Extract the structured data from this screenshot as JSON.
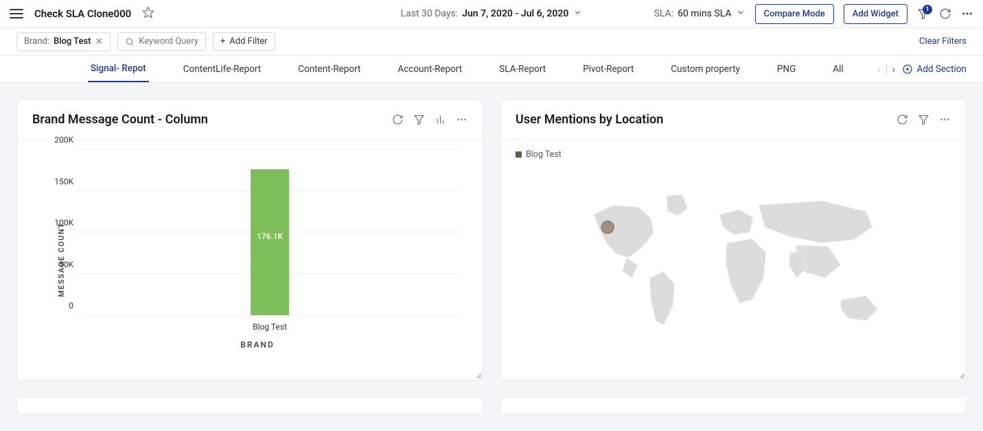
{
  "header": {
    "title": "Check SLA Clone000",
    "date_label": "Last 30 Days:",
    "date_value": "Jun 7, 2020 - Jul 6, 2020",
    "sla_label": "SLA:",
    "sla_value": "60 mins SLA",
    "compare_button": "Compare Mode",
    "add_widget_button": "Add Widget",
    "filter_badge": "1"
  },
  "filters": {
    "brand_label": "Brand:",
    "brand_value": "Blog Test",
    "keyword_placeholder": "Keyword Query",
    "add_filter": "Add Filter",
    "clear": "Clear Filters"
  },
  "tabs": {
    "items": [
      "Signal- Repot",
      "ContentLife-Report",
      "Content-Report",
      "Account-Report",
      "SLA-Report",
      "Pivot-Report",
      "Custom property",
      "PNG",
      "All"
    ],
    "active_index": 0,
    "add_section": "Add Section"
  },
  "widgets": {
    "chart": {
      "title": "Brand Message Count - Column",
      "y_title": "MESSAGE COUNT",
      "x_title": "BRAND",
      "y_ticks": [
        "0",
        "50K",
        "100K",
        "150K",
        "200K"
      ],
      "category": "Blog Test",
      "value_label": "176.1K"
    },
    "map": {
      "title": "User Mentions by Location",
      "legend": "Blog Test"
    }
  },
  "chart_data": {
    "type": "bar",
    "categories": [
      "Blog Test"
    ],
    "values": [
      176100
    ],
    "title": "Brand Message Count - Column",
    "xlabel": "BRAND",
    "ylabel": "MESSAGE COUNT",
    "ylim": [
      0,
      200000
    ]
  }
}
